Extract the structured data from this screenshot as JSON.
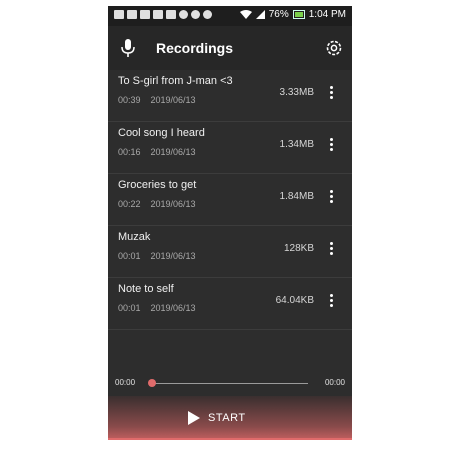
{
  "status_bar": {
    "battery": "76%",
    "time": "1:04 PM"
  },
  "app_bar": {
    "title": "Recordings"
  },
  "recordings": [
    {
      "name": "To S-girl from J-man <3",
      "duration": "00:39",
      "date": "2019/06/13",
      "size": "3.33MB"
    },
    {
      "name": "Cool song I heard",
      "duration": "00:16",
      "date": "2019/06/13",
      "size": "1.34MB"
    },
    {
      "name": "Groceries to get",
      "duration": "00:22",
      "date": "2019/06/13",
      "size": "1.84MB"
    },
    {
      "name": "Muzak",
      "duration": "00:01",
      "date": "2019/06/13",
      "size": "128KB"
    },
    {
      "name": "Note to self",
      "duration": "00:01",
      "date": "2019/06/13",
      "size": "64.04KB"
    }
  ],
  "player": {
    "elapsed": "00:00",
    "total": "00:00",
    "progress": 0
  },
  "start_button": {
    "label": "START"
  },
  "colors": {
    "accent": "#e06b6b",
    "background": "#2d2d2d"
  }
}
